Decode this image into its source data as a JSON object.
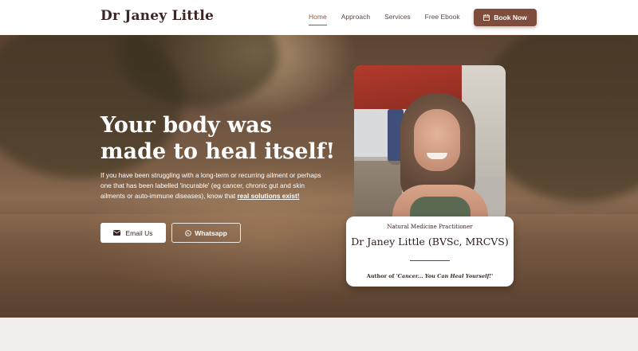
{
  "header": {
    "logo": "Dr Janey Little",
    "nav": [
      "Home",
      "Approach",
      "Services",
      "Free Ebook"
    ],
    "book_label": "Book Now"
  },
  "hero": {
    "title_line1": "Your body was",
    "title_line2": "made to heal itself!",
    "text": "If you have been struggling with a long-term or recurring ailment or perhaps one that has been labelled 'incurable' (eg cancer, chronic gut and skin ailments or auto-immune diseases), know that ",
    "text_link": "real solutions exist!",
    "email_label": "Email Us",
    "whatsapp_label": "Whatsapp"
  },
  "card": {
    "subtitle": "Natural Medicine Practitioner",
    "name": "Dr Janey Little (BVSc, MRCVS)",
    "author_prefix": "Author of ",
    "book_title": "'Cancer... You Can Heal Yourself!'"
  },
  "colors": {
    "accent": "#7e4d3c",
    "text_dark": "#3a2622",
    "footer_bg": "#f2eeed"
  },
  "icons": {
    "book": "calendar-icon",
    "email": "envelope-icon",
    "whatsapp": "whatsapp-icon"
  }
}
